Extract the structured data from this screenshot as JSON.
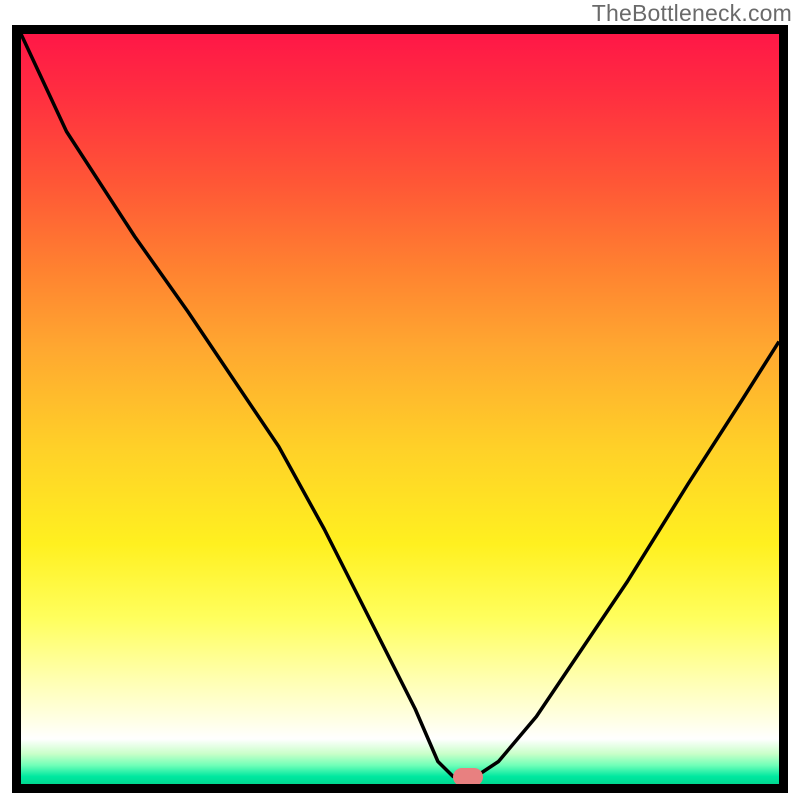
{
  "watermark": "TheBottleneck.com",
  "chart_data": {
    "type": "line",
    "title": "",
    "xlabel": "",
    "ylabel": "",
    "xlim": [
      0,
      100
    ],
    "ylim": [
      0,
      100
    ],
    "grid": false,
    "series": [
      {
        "name": "bottleneck-curve",
        "x": [
          0,
          6,
          15,
          22,
          28,
          34,
          40,
          46,
          52,
          55,
          57,
          60,
          63,
          68,
          74,
          80,
          88,
          95,
          100
        ],
        "values": [
          100,
          87,
          73,
          63,
          54,
          45,
          34,
          22,
          10,
          3,
          1,
          1,
          3,
          9,
          18,
          27,
          40,
          51,
          59
        ]
      }
    ],
    "notch_marker": {
      "x": 59,
      "y": 1
    },
    "background_gradient_stops": [
      {
        "pos": 0,
        "color": "#ff1747"
      },
      {
        "pos": 0.08,
        "color": "#ff2e40"
      },
      {
        "pos": 0.2,
        "color": "#ff5736"
      },
      {
        "pos": 0.32,
        "color": "#ff8430"
      },
      {
        "pos": 0.42,
        "color": "#ffa830"
      },
      {
        "pos": 0.55,
        "color": "#ffd028"
      },
      {
        "pos": 0.68,
        "color": "#fff020"
      },
      {
        "pos": 0.78,
        "color": "#ffff5e"
      },
      {
        "pos": 0.86,
        "color": "#ffffb0"
      },
      {
        "pos": 0.91,
        "color": "#ffffe0"
      },
      {
        "pos": 0.94,
        "color": "#ffffff"
      },
      {
        "pos": 0.96,
        "color": "#c8ffc8"
      },
      {
        "pos": 0.975,
        "color": "#70ffb8"
      },
      {
        "pos": 0.99,
        "color": "#00e8a0"
      },
      {
        "pos": 1.0,
        "color": "#00d890"
      }
    ]
  }
}
